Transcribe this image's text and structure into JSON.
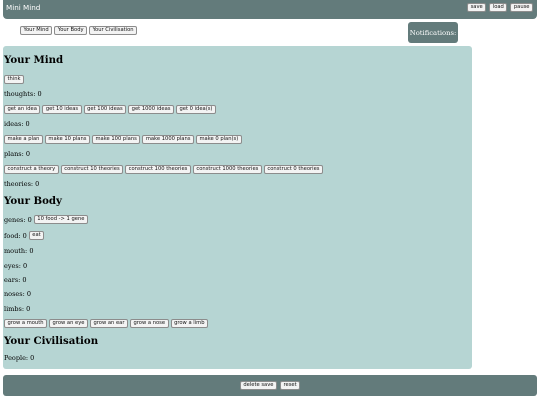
{
  "header": {
    "title": "Mini Mind",
    "buttons": {
      "save": "save",
      "load": "load",
      "pause": "pause"
    }
  },
  "tabs": [
    "Your Mind",
    "Your Body",
    "Your Civilisation"
  ],
  "notifications": {
    "label": "Notifications:"
  },
  "mind": {
    "heading": "Your Mind",
    "think_button": "think",
    "thoughts": "thoughts: 0",
    "idea_buttons": [
      "get an idea",
      "get 10 ideas",
      "get 100 ideas",
      "get 1000 ideas",
      "get 0 idea(s)"
    ],
    "ideas": "ideas: 0",
    "plan_buttons": [
      "make a plan",
      "make 10 plans",
      "make 100 plans",
      "make 1000 plans",
      "make 0 plan(s)"
    ],
    "plans": "plans: 0",
    "theory_buttons": [
      "construct a theory",
      "construct 10 theories",
      "construct 100 theories",
      "construct 1000 theories",
      "construct 0 theories"
    ],
    "theories": "theories: 0"
  },
  "body": {
    "heading": "Your Body",
    "genes": "genes: 0",
    "genes_button": "10 food -> 1 gene",
    "food": "food: 0",
    "eat_button": "eat",
    "mouth": "mouth: 0",
    "eyes": "eyes: 0",
    "ears": "ears: 0",
    "noses": "noses: 0",
    "limbs": "limbs: 0",
    "grow_buttons": [
      "grow a mouth",
      "grow an eye",
      "grow an ear",
      "grow a nose",
      "grow a limb"
    ]
  },
  "civilisation": {
    "heading": "Your Civilisation",
    "people": "People: 0"
  },
  "footer": {
    "delete_save": "delete save",
    "reset": "reset"
  }
}
